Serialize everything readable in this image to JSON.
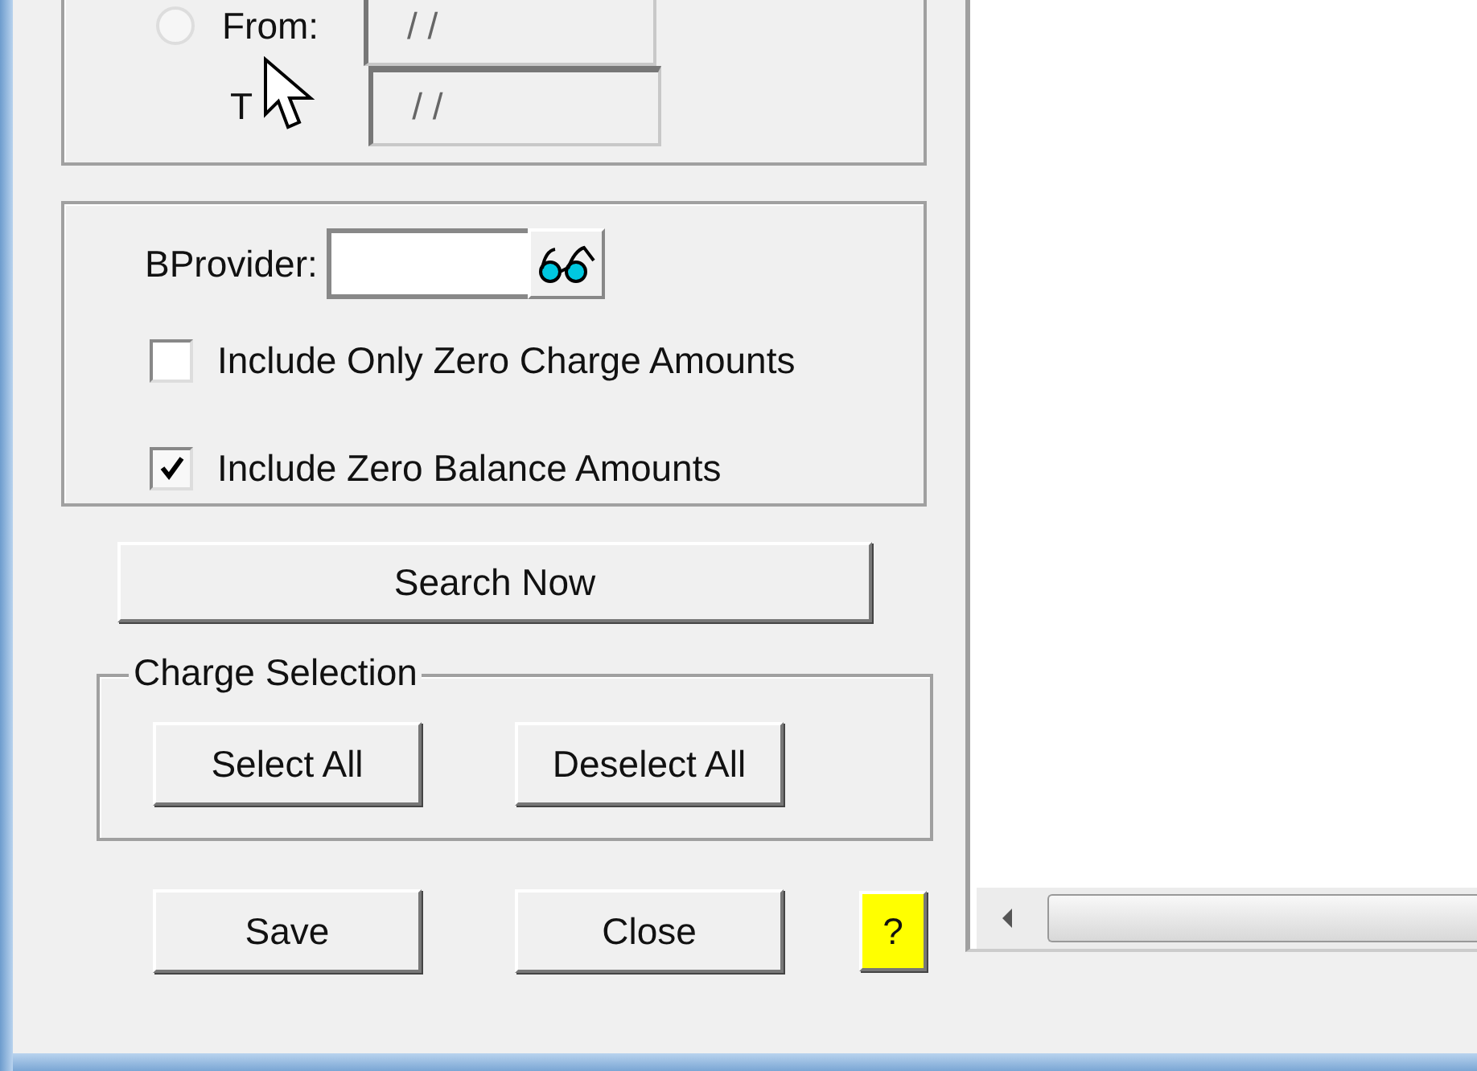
{
  "date_range": {
    "from": {
      "label": "From:",
      "selected": false,
      "field": {
        "value": "/ /",
        "disabled": true
      }
    },
    "to": {
      "label": "T",
      "field": {
        "value": "/ /",
        "disabled": true
      }
    }
  },
  "provider": {
    "label": "BProvider:"
  },
  "options": [
    {
      "label": "Include Only Zero Charge Amounts",
      "checked": false
    },
    {
      "label": "Include Zero Balance Amounts",
      "checked": true
    }
  ],
  "search_button": "Search Now",
  "charge_selection": {
    "title": "Charge Selection",
    "buttons": [
      "Select All",
      "Deselect All"
    ]
  },
  "footer_buttons": [
    {
      "label": "Save",
      "kind": "normal"
    },
    {
      "label": "Close",
      "kind": "normal"
    },
    {
      "label": "?",
      "kind": "help"
    }
  ]
}
